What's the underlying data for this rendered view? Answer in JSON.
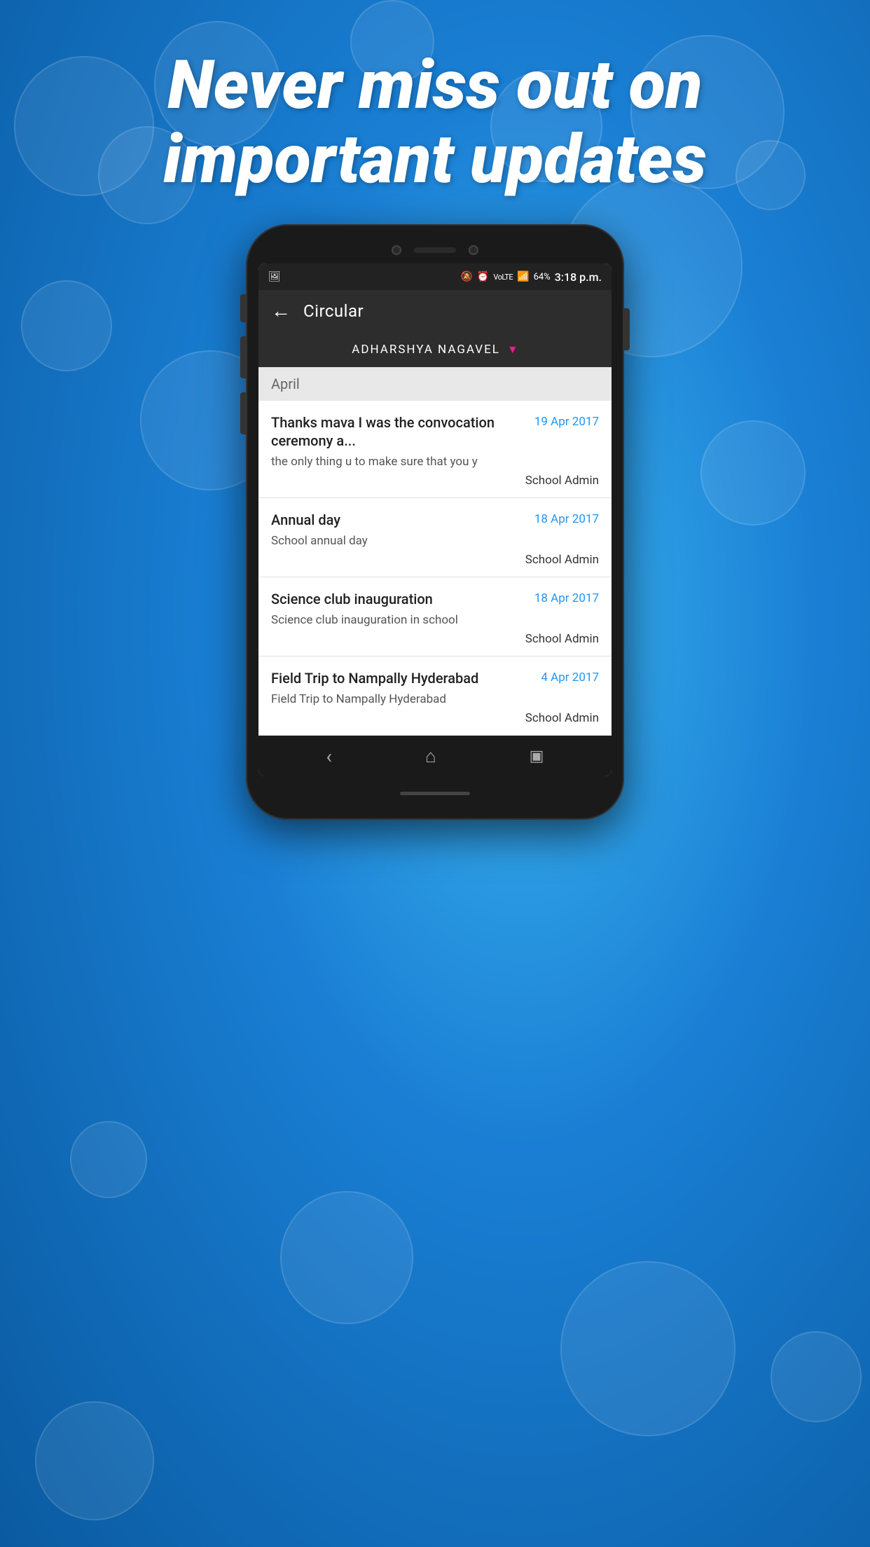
{
  "page": {
    "headline": "Never miss out on important updates",
    "background_color": "#1a7fd4"
  },
  "toolbar": {
    "title": "Circular",
    "back_label": "←"
  },
  "student_selector": {
    "name": "ADHARSHYA  NAGAVEL",
    "dropdown_symbol": "▼"
  },
  "status_bar": {
    "time": "3:18 p.m.",
    "battery": "64%",
    "signal_icon": "📶"
  },
  "month_section": {
    "label": "April"
  },
  "circulars": [
    {
      "title": "Thanks mava I was the convocation ceremony a...",
      "date": "19 Apr 2017",
      "body": "the only thing u to make sure that you y",
      "author": "School Admin"
    },
    {
      "title": "Annual day",
      "date": "18 Apr 2017",
      "body": "School annual day",
      "author": "School Admin"
    },
    {
      "title": "Science club inauguration",
      "date": "18 Apr 2017",
      "body": "Science club inauguration in school",
      "author": "School Admin"
    },
    {
      "title": "Field Trip to Nampally Hyderabad",
      "date": "4 Apr 2017",
      "body": "Field Trip to Nampally Hyderabad",
      "author": "School Admin"
    }
  ],
  "bottom_nav": {
    "back_icon": "‹",
    "home_icon": "⌂",
    "recents_icon": "▣"
  }
}
